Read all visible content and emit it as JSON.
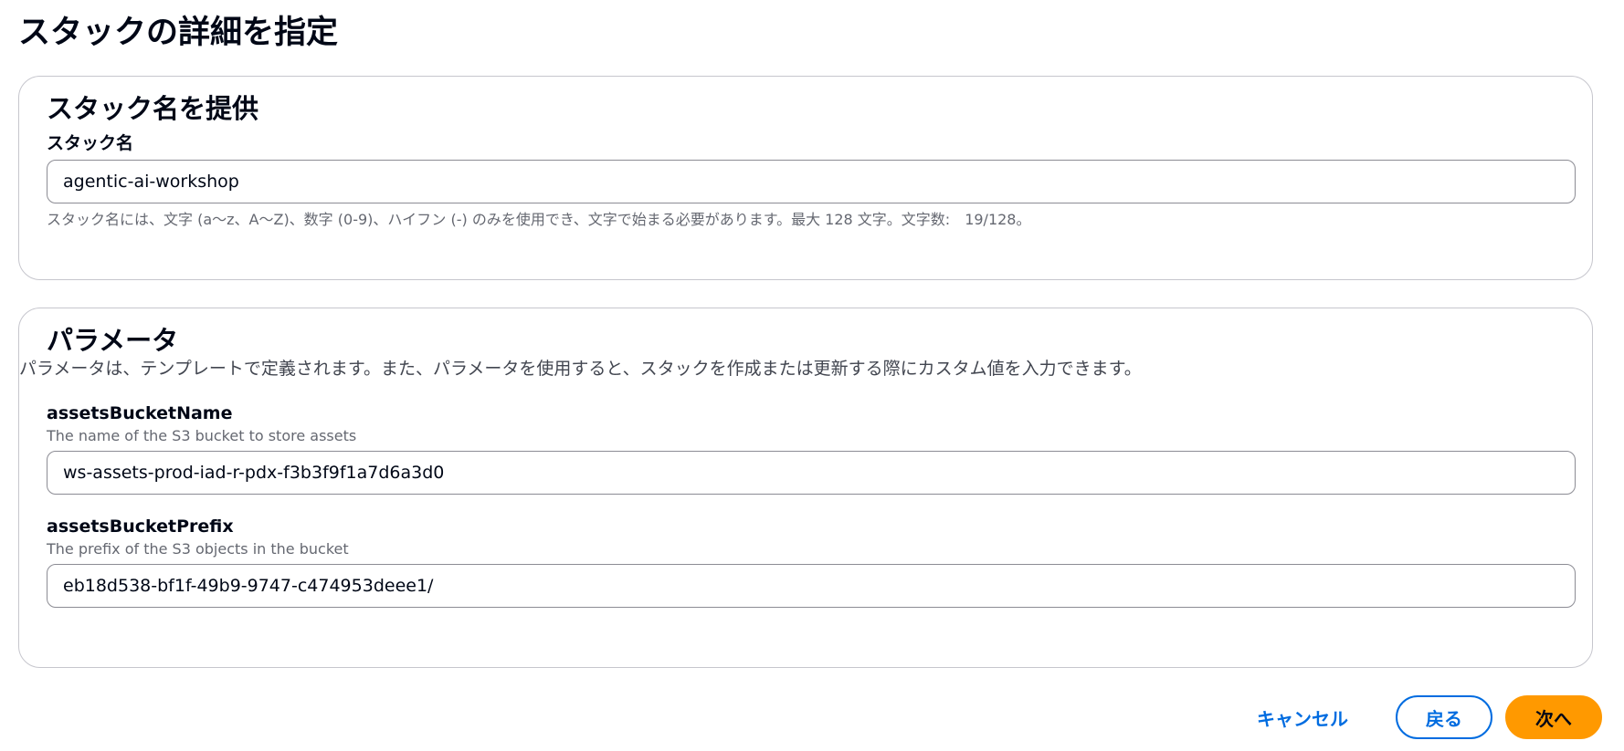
{
  "page": {
    "title": "スタックの詳細を指定"
  },
  "stack_name_section": {
    "title": "スタック名を提供",
    "field_label": "スタック名",
    "field_value": "agentic-ai-workshop",
    "constraint_text": "スタック名には、文字 (a〜z、A〜Z)、数字 (0-9)、ハイフン (-) のみを使用でき、文字で始まる必要があります。最大 128 文字。文字数:　19/128。"
  },
  "parameters_section": {
    "title": "パラメータ",
    "description": "パラメータは、テンプレートで定義されます。また、パラメータを使用すると、スタックを作成または更新する際にカスタム値を入力できます。",
    "params": [
      {
        "label": "assetsBucketName",
        "description": "The name of the S3 bucket to store assets",
        "value": "ws-assets-prod-iad-r-pdx-f3b3f9f1a7d6a3d0"
      },
      {
        "label": "assetsBucketPrefix",
        "description": "The prefix of the S3 objects in the bucket",
        "value": "eb18d538-bf1f-49b9-9747-c474953deee1/"
      }
    ]
  },
  "footer": {
    "cancel_label": "キャンセル",
    "back_label": "戻る",
    "next_label": "次へ"
  },
  "colors": {
    "primary_link": "#006ce0",
    "primary_button": "#ff9900",
    "border": "#c6c6cd"
  }
}
